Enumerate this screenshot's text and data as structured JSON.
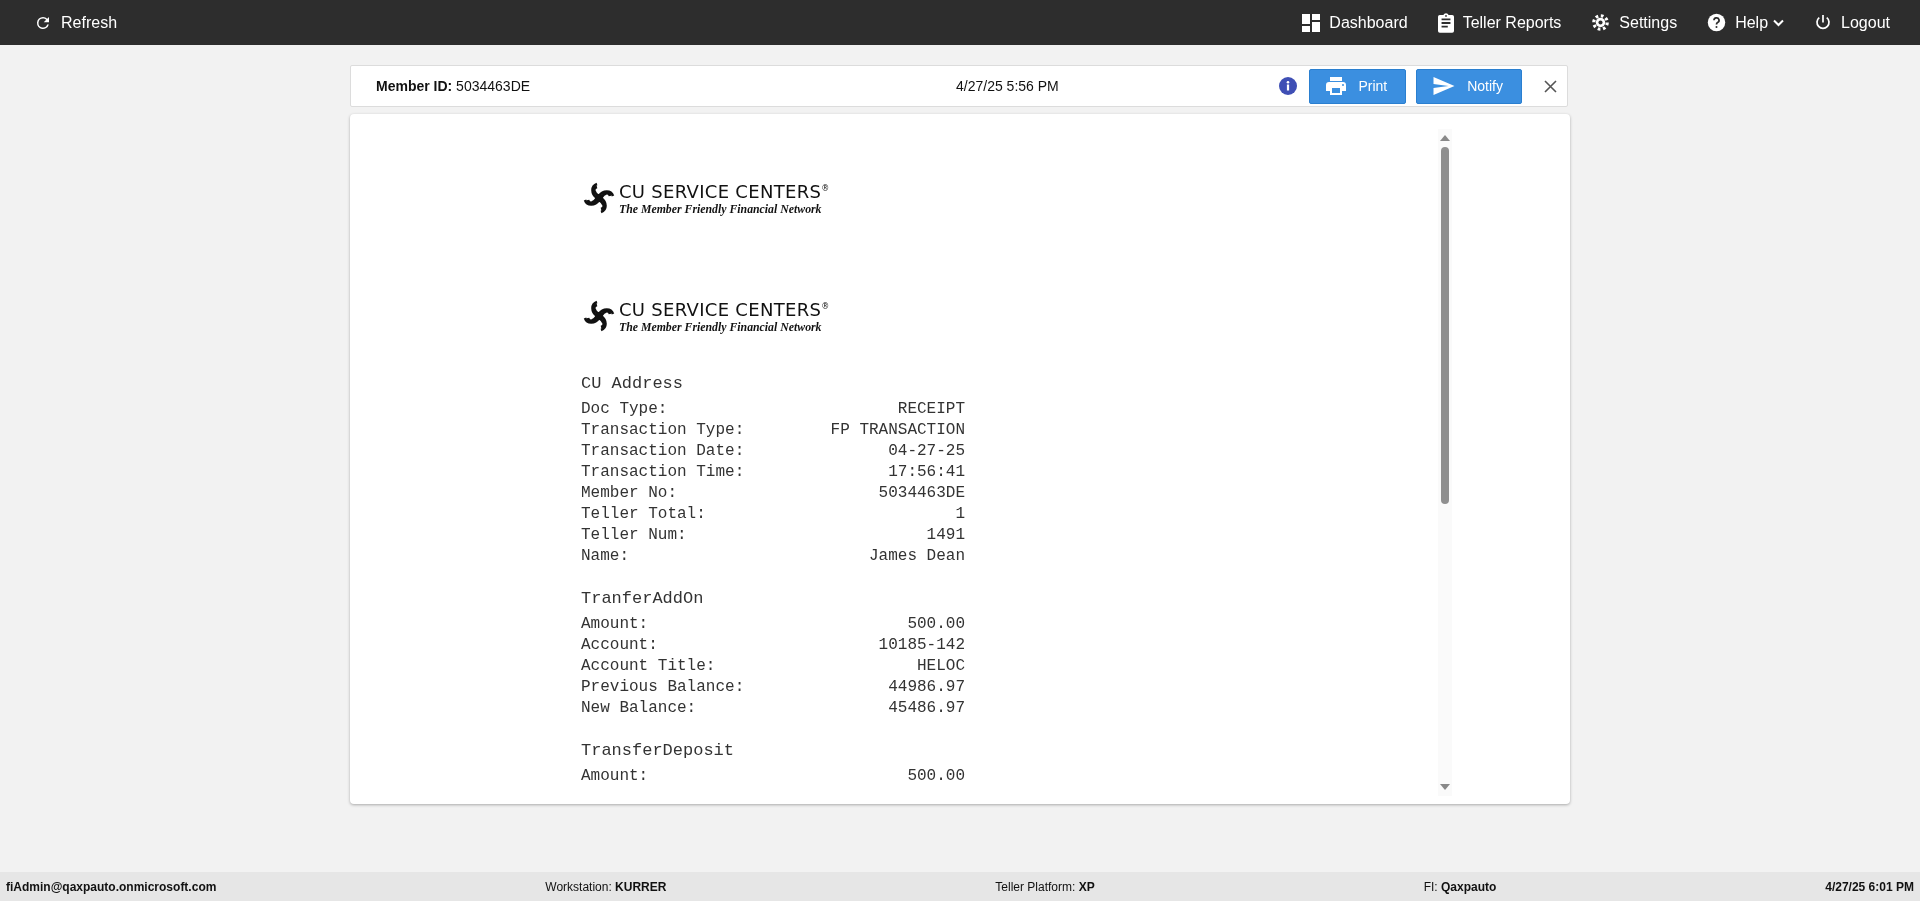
{
  "top_bar": {
    "refresh": {
      "label": "Refresh"
    },
    "links": [
      {
        "label": "Dashboard",
        "menu": false
      },
      {
        "label": "Teller Reports",
        "menu": false
      },
      {
        "label": "Settings",
        "menu": false
      },
      {
        "label": "Help",
        "menu": true
      },
      {
        "label": "Logout",
        "menu": false
      }
    ]
  },
  "header": {
    "member": "**Member ID:** 5034463DE",
    "datetime": "4/27/25 5:56 PM",
    "buttons": [
      {
        "label": "Print"
      },
      {
        "label": "Notify"
      }
    ]
  },
  "receipt": {
    "logos": [
      {
        "name": "CU SERVICE CENTERS$^{®}$",
        "tagline": "The Member Friendly Financial Network"
      },
      {
        "name": "CU SERVICE CENTERS$^{®}$",
        "tagline": "The Member Friendly Financial Network"
      }
    ],
    "sections": [
      {
        "title": "CU Address",
        "rows": [
          [
            "Doc Type:",
            "RECEIPT"
          ],
          [
            "Transaction Type:",
            "FP TRANSACTION"
          ],
          [
            "Transaction Date:",
            "04-27-25"
          ],
          [
            "Transaction Time:",
            "17:56:41"
          ],
          [
            "Member No:",
            "5034463DE"
          ],
          [
            "Teller Total:",
            "1"
          ],
          [
            "Teller Num:",
            "1491"
          ],
          [
            "Name:",
            "James Dean"
          ]
        ]
      },
      {
        "title": "TranferAddOn",
        "rows": [
          [
            "Amount:",
            "500.00"
          ],
          [
            "Account:",
            "10185-142"
          ],
          [
            "Account Title:",
            "HELOC"
          ],
          [
            "Previous Balance:",
            "44986.97"
          ],
          [
            "New Balance:",
            "45486.97"
          ]
        ]
      },
      {
        "title": "TransferDeposit",
        "rows": [
          [
            "Amount:",
            "500.00"
          ]
        ]
      }
    ]
  },
  "status_bar": [
    {
      "kind": "user",
      "text": "fiAdmin@qaxpauto.onmicrosoft.com"
    },
    {
      "kind": "info",
      "text": "Workstation: **KURRER**"
    },
    {
      "kind": "info",
      "text": "Teller Platform: **XP**"
    },
    {
      "kind": "info",
      "text": "FI: **Qaxpauto**"
    },
    {
      "kind": "time",
      "text": "4/27/25 6:01 PM"
    }
  ]
}
